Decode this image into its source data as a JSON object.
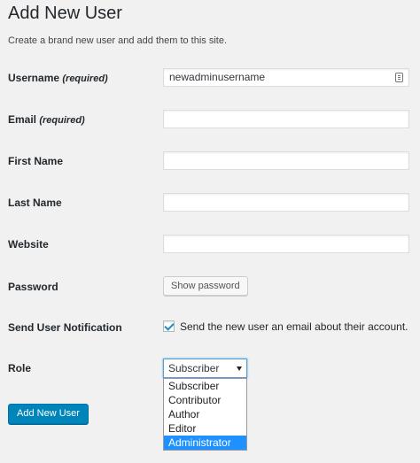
{
  "page": {
    "title": "Add New User",
    "description": "Create a brand new user and add them to this site."
  },
  "form": {
    "username": {
      "label": "Username",
      "required_note": "(required)",
      "value": "newadminusername",
      "icon": "id-card-icon"
    },
    "email": {
      "label": "Email",
      "required_note": "(required)",
      "value": ""
    },
    "first_name": {
      "label": "First Name",
      "value": ""
    },
    "last_name": {
      "label": "Last Name",
      "value": ""
    },
    "website": {
      "label": "Website",
      "value": ""
    },
    "password": {
      "label": "Password",
      "button_label": "Show password"
    },
    "notification": {
      "label": "Send User Notification",
      "checkbox_label": "Send the new user an email about their account.",
      "checked": true
    },
    "role": {
      "label": "Role",
      "selected": "Subscriber",
      "options": [
        "Subscriber",
        "Contributor",
        "Author",
        "Editor",
        "Administrator"
      ],
      "highlighted_option": "Administrator"
    }
  },
  "submit_label": "Add New User",
  "colors": {
    "background": "#f1f1f1",
    "primary_button": "#0085ba",
    "checkmark": "#1e8cbe",
    "dropdown_highlight": "#1e90ff"
  }
}
